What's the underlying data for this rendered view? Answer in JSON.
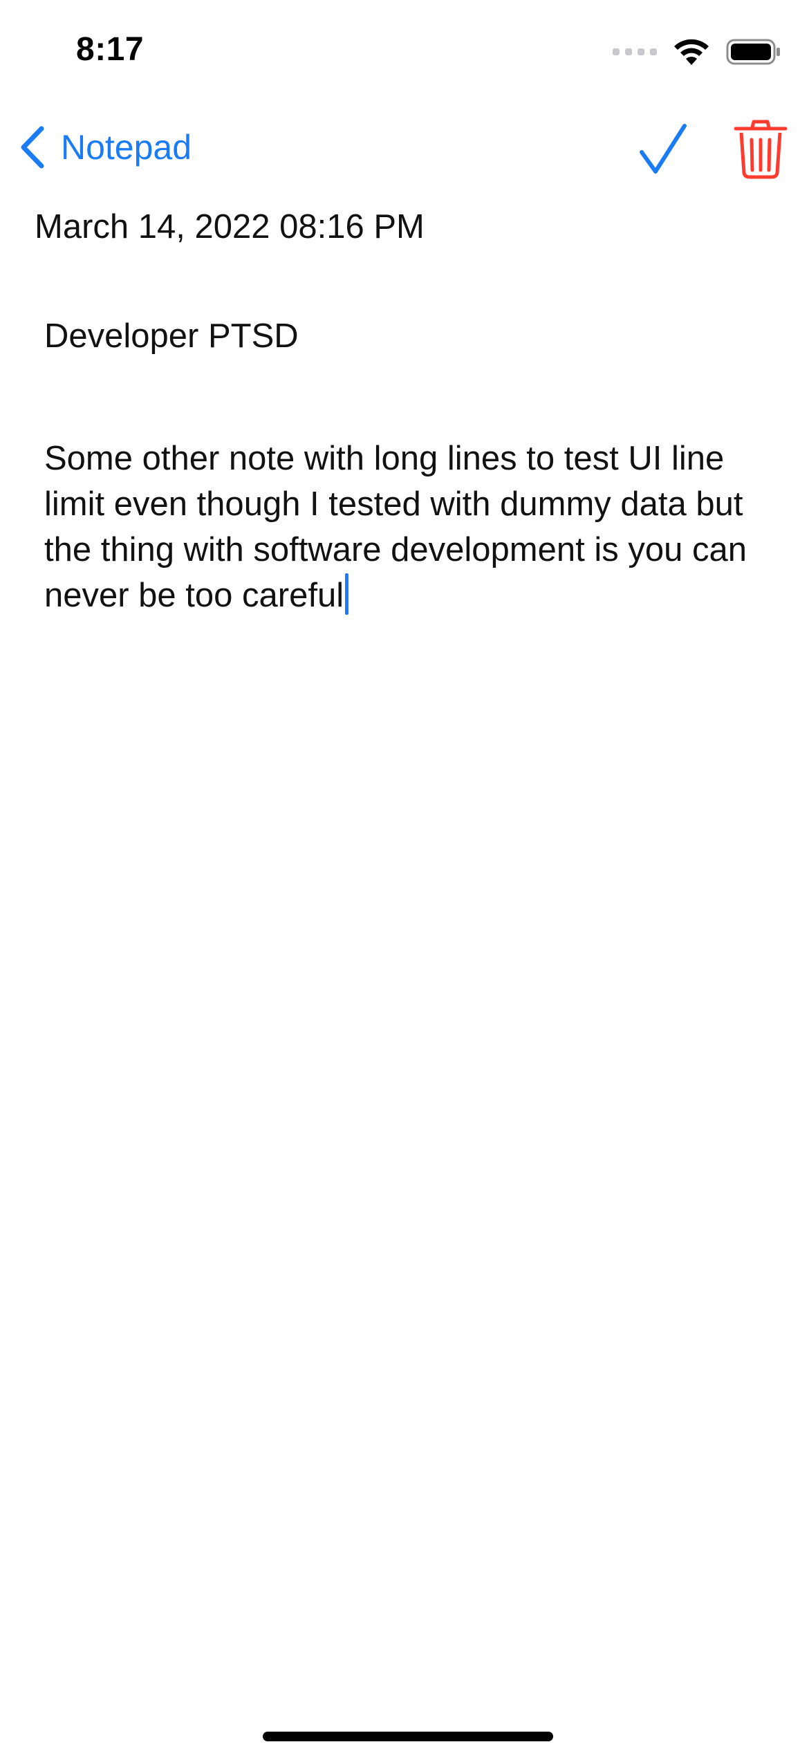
{
  "status_bar": {
    "time": "8:17"
  },
  "nav": {
    "back_label": "Notepad",
    "accent_color": "#1a7cf5",
    "delete_color": "#ff3b30",
    "icons": {
      "back": "chevron-left-icon",
      "done": "checkmark-icon",
      "delete": "trash-icon"
    }
  },
  "note": {
    "date": "March 14, 2022 08:16 PM",
    "title": "Developer PTSD",
    "body": "Some other note with long lines to test UI line limit even though I tested with dummy data but the thing with software development is you can never be too careful"
  }
}
